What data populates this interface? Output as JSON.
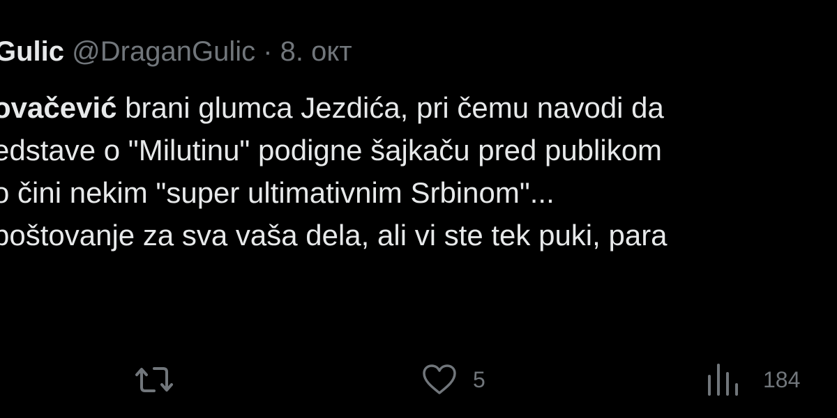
{
  "tweet": {
    "display_name": "Gulic",
    "handle": "@DraganGulic",
    "separator": "·",
    "date": "8. окт",
    "lines": [
      {
        "bold": "ovačević",
        "text": " brani glumca Jezdića, pri čemu navodi da"
      },
      {
        "bold": "",
        "text": "edstave o \"Milutinu\" podigne šajkaču pred publikom"
      },
      {
        "bold": "",
        "text": "o čini nekim \"super ultimativnim Srbinom\"..."
      },
      {
        "bold": "",
        "text": "poštovanje za sva vaša dela, ali vi ste tek puki, para"
      },
      {
        "bold": "",
        "text": "."
      }
    ],
    "actions": {
      "retweet_icon": "retweet-icon",
      "like_icon": "heart-icon",
      "like_count": "5",
      "views_icon": "bar-chart-icon",
      "views_count": "184"
    }
  },
  "colors": {
    "background": "#000000",
    "text": "#e7e9ea",
    "secondary": "#71767b"
  }
}
